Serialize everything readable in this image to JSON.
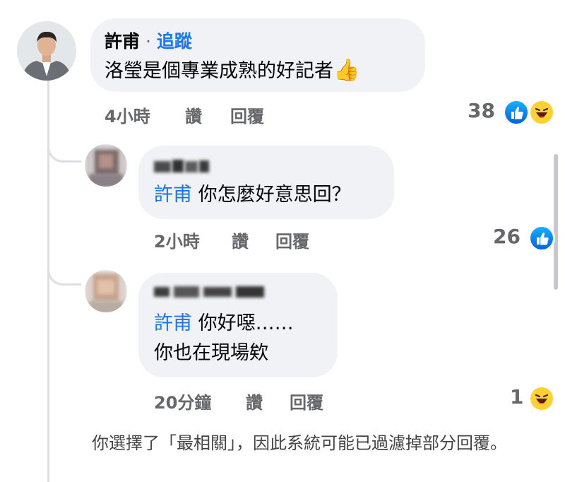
{
  "comment1": {
    "author": "許甫",
    "separator": " · ",
    "follow": "追蹤",
    "text": "洛瑩是個專業成熟的好記者",
    "emoji": "👍",
    "time": "4小時",
    "like": "讚",
    "reply": "回覆",
    "reaction_count": "38",
    "reactions": [
      "like-reaction-icon",
      "haha-reaction-icon"
    ]
  },
  "reply1": {
    "author_pixelated": "pixelated",
    "mention": "許甫",
    "text": " 你怎麼好意思回？",
    "time": "2小時",
    "like": "讚",
    "reply": "回覆",
    "reaction_count": "26",
    "reactions": [
      "like-reaction-icon"
    ]
  },
  "reply2": {
    "author_pixelated": "pixelated",
    "mention": "許甫",
    "text_line1": " 你好噁……",
    "text_line2": "你也在現場欸",
    "time": "20分鐘",
    "like": "讚",
    "reply": "回覆",
    "reaction_count": "1",
    "reactions": [
      "haha-reaction-icon"
    ]
  },
  "notice": "你選擇了「最相關」，因此系統可能已過濾掉部分回覆。",
  "colors": {
    "link": "#1877f2",
    "bubble": "#f0f2f5",
    "meta": "#65676b",
    "thread_line": "#dcdfe3"
  }
}
